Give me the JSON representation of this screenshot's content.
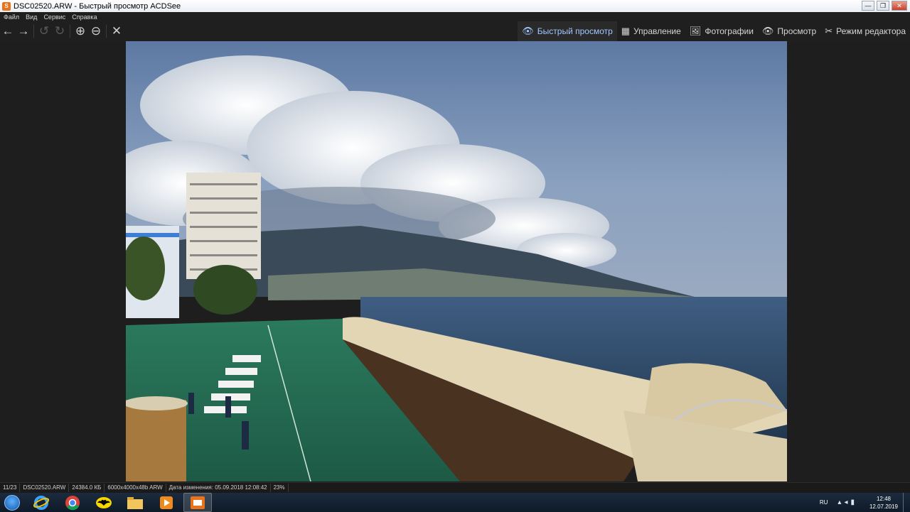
{
  "window": {
    "title": "DSC02520.ARW - Быстрый просмотр ACDSee",
    "icon": "acdsee-icon",
    "controls": {
      "minimize": "—",
      "maximize": "❐",
      "close": "✕"
    }
  },
  "menu": [
    {
      "id": "file",
      "label": "Файл"
    },
    {
      "id": "view",
      "label": "Вид"
    },
    {
      "id": "service",
      "label": "Сервис"
    },
    {
      "id": "help",
      "label": "Справка"
    }
  ],
  "toolbar": {
    "back": "←",
    "forward": "→",
    "rotate_left": "↺",
    "rotate_right": "↻",
    "zoom_in": "⊕",
    "zoom_out": "⊖",
    "close": "✕"
  },
  "modes": [
    {
      "id": "quickview",
      "label": "Быстрый просмотр",
      "icon": "👁",
      "active": true
    },
    {
      "id": "manage",
      "label": "Управление",
      "icon": "▦"
    },
    {
      "id": "photos",
      "label": "Фотографии",
      "icon": "🖼"
    },
    {
      "id": "view",
      "label": "Просмотр",
      "icon": "👁"
    },
    {
      "id": "edit",
      "label": "Режим редактора",
      "icon": "✂"
    }
  ],
  "status": {
    "index": "11/23",
    "filename": "DSC02520.ARW",
    "size": "24384.0 КБ",
    "dimensions": "6000x4000x48b ARW",
    "modified": "Дата изменения: 05.09.2018 12:08:42",
    "zoom": "23%"
  },
  "taskbar": {
    "lang": "RU",
    "time": "12:48",
    "date": "12.07.2019",
    "apps": [
      {
        "id": "ie",
        "icon": "internet-explorer-icon"
      },
      {
        "id": "chrome",
        "icon": "chrome-icon"
      },
      {
        "id": "batman",
        "icon": "batman-icon"
      },
      {
        "id": "explorer",
        "icon": "folder-icon"
      },
      {
        "id": "media",
        "icon": "media-player-icon"
      },
      {
        "id": "acdsee",
        "icon": "acdsee-icon",
        "active": true
      }
    ]
  }
}
